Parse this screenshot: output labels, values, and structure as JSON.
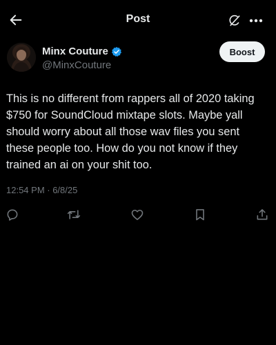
{
  "header": {
    "title": "Post",
    "back_icon": "arrow-left-icon",
    "grok_icon": "grok-icon",
    "more_icon": "more-horizontal-icon"
  },
  "author": {
    "display_name": "Minx Couture",
    "handle": "@MinxCouture",
    "verified": true,
    "verified_color": "#1d9bf0"
  },
  "boost_button": {
    "label": "Boost"
  },
  "post": {
    "text": "This is no different from rappers all of 2020 taking $750 for SoundCloud mixtape slots. Maybe yall should worry about all those wav files you sent these people too. How do you not know if they trained an ai on your shit too.",
    "timestamp": "12:54 PM · 6/8/25"
  },
  "actions": [
    {
      "name": "reply",
      "icon": "reply-icon"
    },
    {
      "name": "repost",
      "icon": "repost-icon"
    },
    {
      "name": "like",
      "icon": "heart-icon"
    },
    {
      "name": "bookmark",
      "icon": "bookmark-icon"
    },
    {
      "name": "share",
      "icon": "share-icon"
    }
  ],
  "colors": {
    "background": "#000000",
    "primary_text": "#e7e9ea",
    "secondary_text": "#71767b",
    "button_bg": "#eff3f4"
  }
}
